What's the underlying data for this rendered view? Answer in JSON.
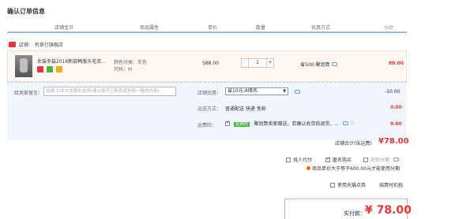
{
  "page": {
    "title": "确认订单信息"
  },
  "columns": [
    "店铺宝贝",
    "商品属性",
    "单价",
    "数量",
    "优惠方式",
    "小计"
  ],
  "shop": {
    "label": "店铺：",
    "name": "有草行旗舰店"
  },
  "item": {
    "name": "女装冬装2016新款韩版头毛衣...",
    "color_label": "颜色分类：灰色",
    "size_label": "尺码：M",
    "price": "588.00",
    "qty_minus": "-",
    "quantity": "1",
    "qty_plus": "+",
    "promo": "省500:聚划算",
    "subtotal": "88.00"
  },
  "message": {
    "label": "给卖家留言：",
    "placeholder": "选填:对本次交易的说明(建议填写已和卖家协商一致的内容)"
  },
  "coupon": {
    "label": "店铺优惠：",
    "selected": "省10元:A储名",
    "amount": "-10.00"
  },
  "shipping": {
    "label": "运送方式：",
    "method": "普通配送 快递 免邮",
    "amount": "0.00"
  },
  "insurance": {
    "label": "运费险：",
    "tag": "运费险",
    "text": "聚划算卖家赠送，若确认收货前退货，...",
    "amount": "0.00"
  },
  "shop_total": {
    "label": "店铺合计(含运费)",
    "value": "¥78.00"
  },
  "options": {
    "proxy_pay": "找人代付",
    "anonymous": "匿名购买",
    "installment": "花呗分期"
  },
  "warning": "商品单价大于等于600.00元才能使用分期",
  "tmall_points": "使用天猫点券",
  "split_settlement": "结算时扣抵",
  "final": {
    "label": "实付款：",
    "value": "¥ 78.00"
  },
  "colors": {
    "accent": "#e4393c",
    "border_blue": "#9bb6d6",
    "row_bg": "#f0f6fc"
  }
}
